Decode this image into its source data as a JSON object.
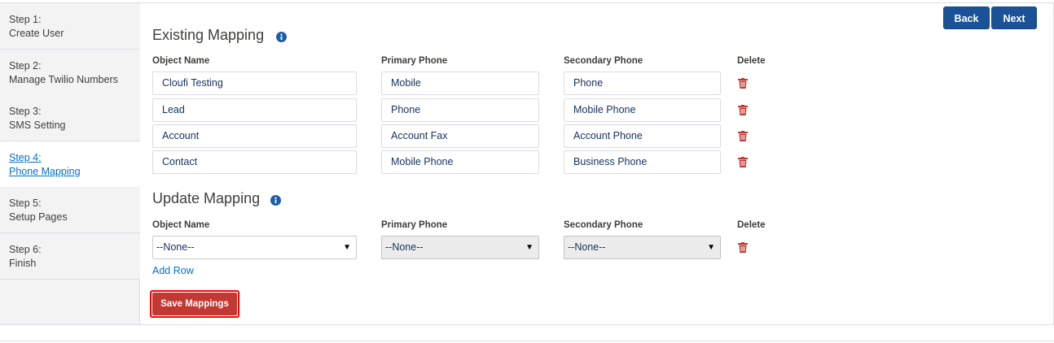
{
  "steps": [
    {
      "num": "Step 1:",
      "name": "Create User"
    },
    {
      "num": "Step 2:",
      "name": "Manage Twilio Numbers"
    },
    {
      "num": "Step 3:",
      "name": "SMS Setting"
    },
    {
      "num": "Step 4:",
      "name": "Phone Mapping"
    },
    {
      "num": "Step 5:",
      "name": "Setup Pages"
    },
    {
      "num": "Step 6:",
      "name": "Finish"
    }
  ],
  "buttons": {
    "back": "Back",
    "next": "Next",
    "add_row": "Add Row",
    "save": "Save Mappings"
  },
  "existing": {
    "title": "Existing Mapping",
    "headers": {
      "object": "Object Name",
      "primary": "Primary Phone",
      "secondary": "Secondary Phone",
      "delete": "Delete"
    },
    "rows": [
      {
        "object": "Cloufi Testing",
        "primary": "Mobile",
        "secondary": "Phone"
      },
      {
        "object": "Lead",
        "primary": "Phone",
        "secondary": "Mobile Phone"
      },
      {
        "object": "Account",
        "primary": "Account Fax",
        "secondary": "Account Phone"
      },
      {
        "object": "Contact",
        "primary": "Mobile Phone",
        "secondary": "Business Phone"
      }
    ]
  },
  "update": {
    "title": "Update Mapping",
    "headers": {
      "object": "Object Name",
      "primary": "Primary Phone",
      "secondary": "Secondary Phone",
      "delete": "Delete"
    },
    "object_value": "--None--",
    "primary_value": "--None--",
    "secondary_value": "--None--"
  },
  "icons": {
    "info": "info-icon",
    "delete": "trash-icon",
    "dropdown": "chevron-down-icon"
  },
  "colors": {
    "accent": "#1b5297",
    "danger": "#c23934",
    "link": "#0070d2"
  }
}
